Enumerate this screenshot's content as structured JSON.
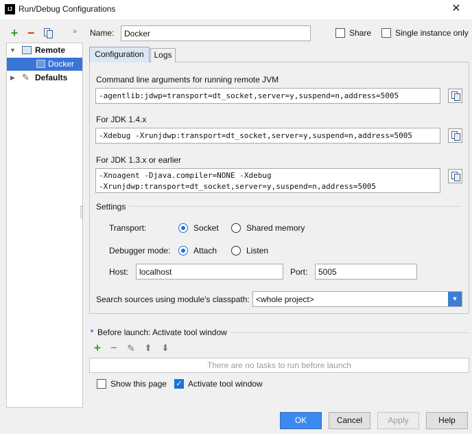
{
  "window": {
    "title": "Run/Debug Configurations",
    "app_icon_letter": "IJ"
  },
  "left": {
    "tree": [
      {
        "label": "Remote",
        "expanded": true
      },
      {
        "label": "Docker",
        "selected": true
      },
      {
        "label": "Defaults",
        "expanded": false
      }
    ]
  },
  "name": {
    "label": "Name:",
    "value": "Docker"
  },
  "share_label": "Share",
  "single_instance_label": "Single instance only",
  "tabs": {
    "configuration": "Configuration",
    "logs": "Logs"
  },
  "config": {
    "cmd_label": "Command line arguments for running remote JVM",
    "cmd_value": "-agentlib:jdwp=transport=dt_socket,server=y,suspend=n,address=5005",
    "jdk14_label": "For JDK 1.4.x",
    "jdk14_value": "-Xdebug -Xrunjdwp:transport=dt_socket,server=y,suspend=n,address=5005",
    "jdk13_label": "For JDK 1.3.x or earlier",
    "jdk13_line1": "-Xnoagent -Djava.compiler=NONE -Xdebug",
    "jdk13_line2": "-Xrunjdwp:transport=dt_socket,server=y,suspend=n,address=5005",
    "settings_label": "Settings",
    "transport_label": "Transport:",
    "transport_options": [
      "Socket",
      "Shared memory"
    ],
    "transport_selected": "Socket",
    "debugger_label": "Debugger mode:",
    "debugger_options": [
      "Attach",
      "Listen"
    ],
    "debugger_selected": "Attach",
    "host_label": "Host:",
    "host_value": "localhost",
    "port_label": "Port:",
    "port_value": "5005",
    "classpath_label": "Search sources using module's classpath:",
    "classpath_value": "<whole project>"
  },
  "before_launch": {
    "title": "Before launch: Activate tool window",
    "empty_text": "There are no tasks to run before launch",
    "show_page_label": "Show this page",
    "show_page_checked": false,
    "activate_label": "Activate tool window",
    "activate_checked": true
  },
  "buttons": {
    "ok": "OK",
    "cancel": "Cancel",
    "apply": "Apply",
    "help": "Help"
  },
  "colors": {
    "accent": "#3c8af0",
    "selection": "#3875d7",
    "add_green": "#2f9e2f",
    "remove_red": "#d9342b"
  }
}
